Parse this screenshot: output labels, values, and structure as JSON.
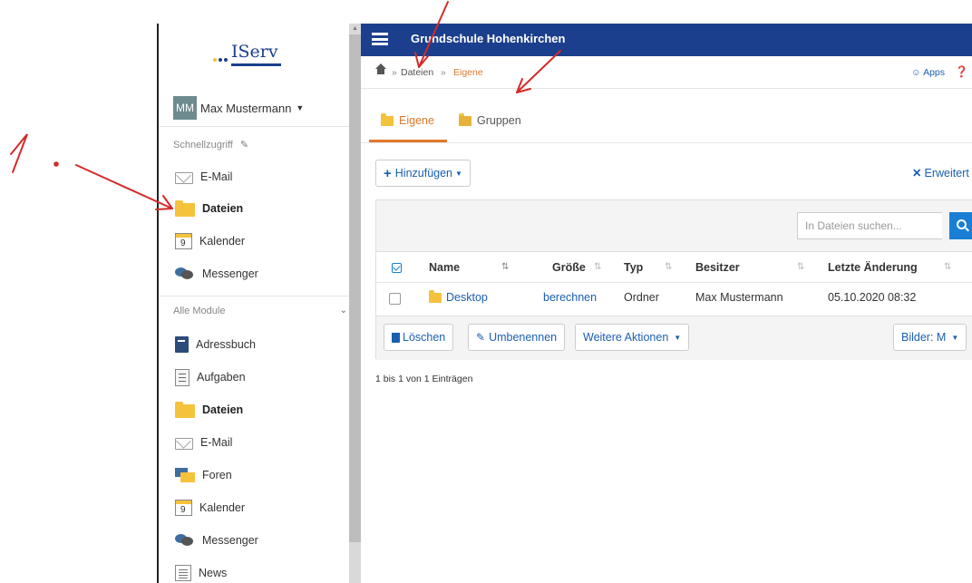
{
  "app": {
    "title": "Grundschule Hohenkirchen",
    "logo_text": "IServ"
  },
  "user": {
    "initials": "MM",
    "name": "Max Mustermann"
  },
  "sidebar": {
    "quick_access_label": "Schnellzugriff",
    "quick_items": [
      {
        "label": "E-Mail",
        "icon": "mail-icon"
      },
      {
        "label": "Dateien",
        "icon": "folder-icon"
      },
      {
        "label": "Kalender",
        "icon": "calendar-icon"
      },
      {
        "label": "Messenger",
        "icon": "messenger-icon"
      }
    ],
    "all_modules_label": "Alle Module",
    "modules": [
      {
        "label": "Adressbuch",
        "icon": "addressbook-icon"
      },
      {
        "label": "Aufgaben",
        "icon": "tasks-icon"
      },
      {
        "label": "Dateien",
        "icon": "folder-icon"
      },
      {
        "label": "E-Mail",
        "icon": "mail-icon"
      },
      {
        "label": "Foren",
        "icon": "forum-icon"
      },
      {
        "label": "Kalender",
        "icon": "calendar-icon"
      },
      {
        "label": "Messenger",
        "icon": "messenger-icon"
      },
      {
        "label": "News",
        "icon": "news-icon"
      }
    ],
    "calendar_day": "9"
  },
  "breadcrumb": {
    "sep": "»",
    "items": [
      "Dateien",
      "Eigene"
    ],
    "apps": "Apps",
    "help": "?"
  },
  "tabs": [
    {
      "label": "Eigene",
      "active": true
    },
    {
      "label": "Gruppen",
      "active": false
    }
  ],
  "toolbar": {
    "add_label": "Hinzufügen",
    "advanced_label": "Erweitert"
  },
  "search": {
    "placeholder": "In Dateien suchen..."
  },
  "table": {
    "columns": [
      "Name",
      "Größe",
      "Typ",
      "Besitzer",
      "Letzte Änderung"
    ],
    "rows": [
      {
        "name": "Desktop",
        "size": "berechnen",
        "type": "Ordner",
        "owner": "Max Mustermann",
        "modified": "05.10.2020 08:32"
      }
    ]
  },
  "actions": {
    "delete": "Löschen",
    "rename": "Umbenennen",
    "more": "Weitere Aktionen",
    "images": "Bilder: M"
  },
  "footer": {
    "entries": "1 bis 1 von 1 Einträgen"
  },
  "annotation": {
    "step_label": "1.",
    "color": "#d42a2a"
  },
  "colors": {
    "brand": "#1b3f8c",
    "accent": "#e0792c",
    "link": "#1b5fb0",
    "search_button": "#1a7fd4"
  }
}
